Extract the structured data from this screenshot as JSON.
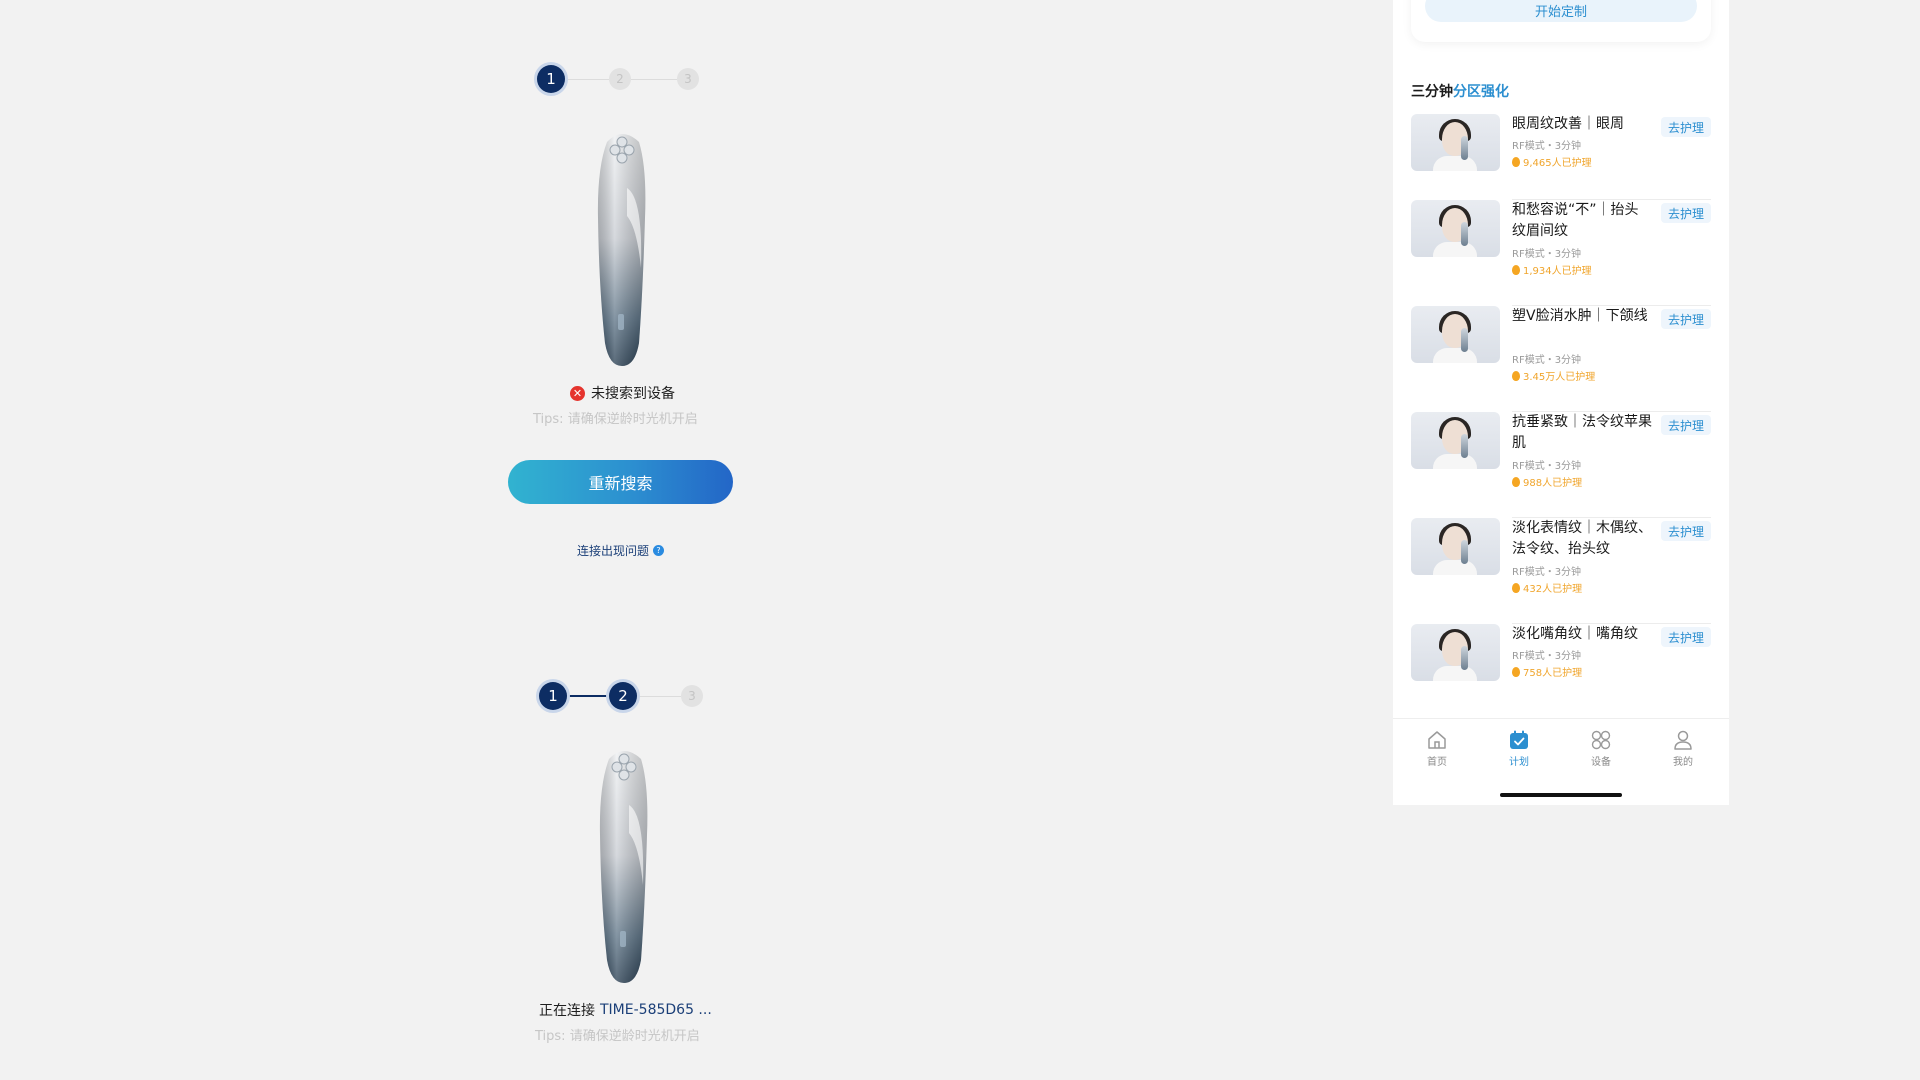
{
  "colors": {
    "navy": "#0d2d63",
    "accent": "#2c8fd0",
    "error": "#e5342e",
    "orange": "#f0a52c"
  },
  "screen1": {
    "steps": [
      "1",
      "2",
      "3"
    ],
    "active_step": 1,
    "status_text": "未搜索到设备",
    "status_icon": "error-x-icon",
    "tips": "Tips: 请确保逆龄时光机开启",
    "retry_label": "重新搜索",
    "problem_link": "连接出现问题",
    "problem_icon": "question-icon"
  },
  "screen2": {
    "steps": [
      "1",
      "2",
      "3"
    ],
    "active_step": 2,
    "connecting_prefix": "正在连接",
    "device_name": "TIME-585D65 ...",
    "tips": "Tips: 请确保逆龄时光机开启"
  },
  "phone": {
    "top_button": "开始定制",
    "section_title_prefix": "三分钟",
    "section_title_highlight": "分区强化",
    "plans": [
      {
        "title": "眼周纹改善｜眼周",
        "meta": "RF模式・3分钟",
        "count": "9,465人已护理",
        "action": "去护理"
      },
      {
        "title": "和愁容说“不”｜抬头纹眉间纹",
        "meta": "RF模式・3分钟",
        "count": "1,934人已护理",
        "action": "去护理"
      },
      {
        "title": "塑V脸消水肿｜下颌线",
        "meta": "RF模式・3分钟",
        "count": "3.45万人已护理",
        "action": "去护理"
      },
      {
        "title": "抗垂紧致｜法令纹苹果肌",
        "meta": "RF模式・3分钟",
        "count": "988人已护理",
        "action": "去护理"
      },
      {
        "title": "淡化表情纹｜木偶纹、法令纹、抬头纹",
        "meta": "RF模式・3分钟",
        "count": "432人已护理",
        "action": "去护理"
      },
      {
        "title": "淡化嘴角纹｜嘴角纹",
        "meta": "RF模式・3分钟",
        "count": "758人已护理",
        "action": "去护理"
      }
    ],
    "tabs": [
      {
        "label": "首页",
        "icon": "home-icon"
      },
      {
        "label": "计划",
        "icon": "calendar-check-icon",
        "active": true
      },
      {
        "label": "设备",
        "icon": "device-grid-icon"
      },
      {
        "label": "我的",
        "icon": "user-icon"
      }
    ]
  }
}
